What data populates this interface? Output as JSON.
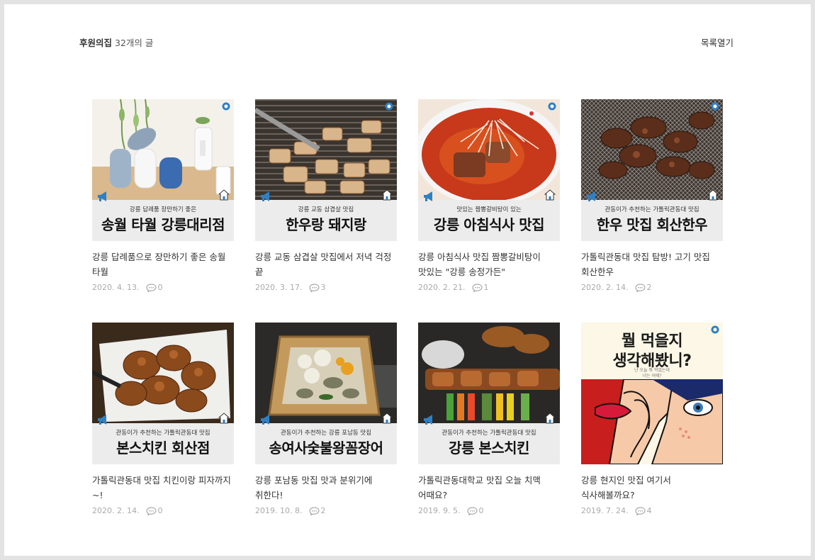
{
  "header": {
    "category": "후원의집",
    "count_text": "32개의 글",
    "toggle_label": "목록열기"
  },
  "colors": {
    "accent_blue": "#2f80c3",
    "muted_meta": "#aaaaaa"
  },
  "posts": [
    {
      "banner_sub": "강릉 답례품 장만하기 좋은",
      "banner_title": "송월 타월 강릉대리점",
      "title": "강릉 답례품으로 장만하기 좋은 송월 타월",
      "date": "2020. 4. 13.",
      "comments": "0"
    },
    {
      "banner_sub": "강릉 교동 삼겹살 맛집",
      "banner_title": "한우랑 돼지랑",
      "title": "강릉 교동 삼겹살 맛집에서 저녁 걱정 끝",
      "date": "2020. 3. 17.",
      "comments": "3"
    },
    {
      "banner_sub": "맛있는 짬뽕갈비탕이 있는",
      "banner_title": "강릉 아침식사 맛집",
      "title": "강릉 아침식사 맛집 짬뽕갈비탕이 맛있는 \"강릉 송정가든\"",
      "date": "2020. 2. 21.",
      "comments": "1"
    },
    {
      "banner_sub": "관동이가 추천하는 가톨릭관동대 맛집",
      "banner_title": "한우 맛집 회산한우",
      "title": "가톨릭관동대 맛집 탐방! 고기 맛집 회산한우",
      "date": "2020. 2. 14.",
      "comments": "2"
    },
    {
      "banner_sub": "관동이가 추천하는 가톨릭관동대 맛집",
      "banner_title": "본스치킨 회산점",
      "title": "가톨릭관동대 맛집 치킨이랑 피자까지~!",
      "date": "2020. 2. 14.",
      "comments": "0"
    },
    {
      "banner_sub": "관동이가 추천하는 강릉 포남동 맛집",
      "banner_title": "송여사숯불왕꼼장어",
      "title": "강릉 포남동 맛집 맛과 분위기에 취한다!",
      "date": "2019. 10. 8.",
      "comments": "2"
    },
    {
      "banner_sub": "관동이가 추천하는 가톨릭관동대 맛집",
      "banner_title": "강릉 본스치킨",
      "title": "가톨릭관동대학교 맛집 오늘 치맥 어때요?",
      "date": "2019. 9. 5.",
      "comments": "0"
    },
    {
      "poster_line1": "뭘 먹을지",
      "poster_line2": "생각해봤니?",
      "poster_small1": "난 오늘 뭐 먹었는데",
      "poster_small2": "너는 어때?",
      "title": "강릉 현지인 맛집 여기서 식사해볼까요?",
      "date": "2019. 7. 24.",
      "comments": "4"
    }
  ]
}
